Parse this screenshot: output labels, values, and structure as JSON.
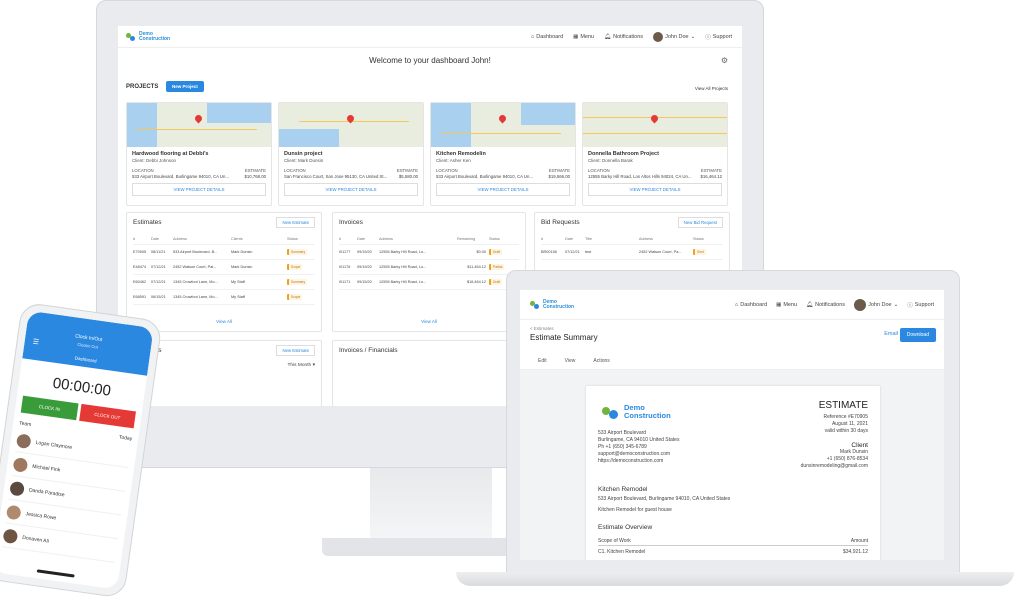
{
  "brand": {
    "logo_text_line1": "Demo",
    "logo_text_line2": "Construction",
    "accent": "#2b88e0"
  },
  "nav": {
    "dashboard": "Dashboard",
    "menu": "Menu",
    "notifications": "Notifications",
    "user": "John Doe",
    "support": "Support"
  },
  "dashboard": {
    "welcome": "Welcome to your dashboard John!",
    "projects_heading": "PROJECTS",
    "new_project": "New Project",
    "view_all_projects": "View All Projects",
    "projects": [
      {
        "title": "Hardwood flooring at Debbi's",
        "client": "Client: Debbi Johnson",
        "location_label": "LOCATION",
        "location": "533 Airport Boulevard, Burlingame 94010, CA Un...",
        "estimate_label": "ESTIMATE",
        "estimate": "$10,768.00",
        "button": "VIEW PROJECT DETAILS"
      },
      {
        "title": "Dunsin project",
        "client": "Client: Mark Dunsin",
        "location_label": "LOCATION",
        "location": "San Francisco Court, San Jose 95130, CA United St...",
        "estimate_label": "ESTIMATE",
        "estimate": "$5,580.00",
        "button": "VIEW PROJECT DETAILS"
      },
      {
        "title": "Kitchen Remodelin",
        "client": "Client: Asher Ken",
        "location_label": "LOCATION",
        "location": "533 Airport Boulevard, Burlingame 94010, CA Un...",
        "estimate_label": "ESTIMATE",
        "estimate": "$19,566.00",
        "button": "VIEW PROJECT DETAILS"
      },
      {
        "title": "Donnella Bathroom Project",
        "client": "Client: Donnella Barak",
        "location_label": "LOCATION",
        "location": "12555 Barky Hill Road, Los Altos Hills 94024, CA Un...",
        "estimate_label": "ESTIMATE",
        "estimate": "$16,464.12",
        "button": "VIEW PROJECT DETAILS"
      }
    ],
    "estimates": {
      "title": "Estimates",
      "button": "New Estimate",
      "view_all": "View All",
      "headers": [
        "#",
        "Date",
        "Address",
        "Clients",
        "Status"
      ],
      "rows": [
        [
          "E70905",
          "08/11/21",
          "533 Airport Boulevard, B...",
          "Mark Dunsin",
          "Summary"
        ],
        [
          "E48474",
          "07/12/21",
          "2452 Watson Court, Pal...",
          "Mark Dunsin",
          "Scope"
        ],
        [
          "E60462",
          "07/12/21",
          "1345 Crowfoot Lane, Mo...",
          "My Staff",
          "Summary"
        ],
        [
          "E68591",
          "06/15/21",
          "1345 Crowfoot Lane, Mo...",
          "My Staff",
          "Scope"
        ]
      ]
    },
    "invoices": {
      "title": "Invoices",
      "view_all": "View All",
      "headers": [
        "#",
        "Date",
        "Address",
        "Remaining",
        "Status"
      ],
      "rows": [
        [
          "I01177",
          "09/19/20",
          "12555 Barky Hill Road, Lo...",
          "$0.00",
          "Draft"
        ],
        [
          "I01176",
          "09/19/20",
          "12555 Barky Hill Road, Lo...",
          "$11,464.12",
          "Partial"
        ],
        [
          "I01171",
          "09/15/20",
          "12555 Barky Hill Road, Lo...",
          "$16,464.12",
          "Draft"
        ]
      ]
    },
    "bid_requests": {
      "title": "Bid Requests",
      "button": "New Bid Request",
      "headers": [
        "#",
        "Date",
        "Title",
        "Address",
        "Status"
      ],
      "rows": [
        [
          "BR00156",
          "07/12/21",
          "test",
          "2452 Watson Court, Pa...",
          "Sent"
        ]
      ]
    },
    "estimates2": {
      "title": "Estimates",
      "button": "New Estimate",
      "filter": "This Month"
    },
    "invoices_financials": {
      "title": "Invoices / Financials"
    }
  },
  "laptop": {
    "breadcrumb": "< Estimates",
    "title": "Estimate Summary",
    "email": "Email",
    "download": "Download",
    "tabs": [
      "Edit",
      "View",
      "Actions"
    ],
    "doc": {
      "logo_line1": "Demo",
      "logo_line2": "Construction",
      "heading": "ESTIMATE",
      "reference": "Reference #E70905",
      "date": "August 11, 2021",
      "valid": "valid within 30 days",
      "company_address": [
        "533 Airport Boulevard",
        "Burlingame, CA 94010 United States",
        "Ph +1 (650) 345-6789",
        "support@democonstruction.com",
        "https://democonstruction.com"
      ],
      "client_label": "Client",
      "client_lines": [
        "Mark Dunsin",
        "+1 (650) 876-8534",
        "dunsinremodeling@gmail.com"
      ],
      "project_title": "Kitchen Remodel",
      "project_address": "533 Airport Boulevard, Burlingame 94010, CA United States",
      "project_desc": "Kitchen Remodel for guest house",
      "overview_title": "Estimate Overview",
      "scope_label": "Scope of Work",
      "amount_label": "Amount",
      "line_item": "C1. Kitchen Remodel",
      "line_amount": "$34,921.12"
    }
  },
  "phone": {
    "header_title": "Clock In/Out",
    "header_sub": "Clockin Out",
    "tab": "Dashboard",
    "timer": "00:00:00",
    "clock_in": "CLOCK IN",
    "clock_out": "CLOCK OUT",
    "team_label": "Team",
    "today_label": "Today",
    "members": [
      "Logan Claymore",
      "Michael Fink",
      "Danda Paradise",
      "Jessica Rowe",
      "Donaven Ali"
    ]
  }
}
